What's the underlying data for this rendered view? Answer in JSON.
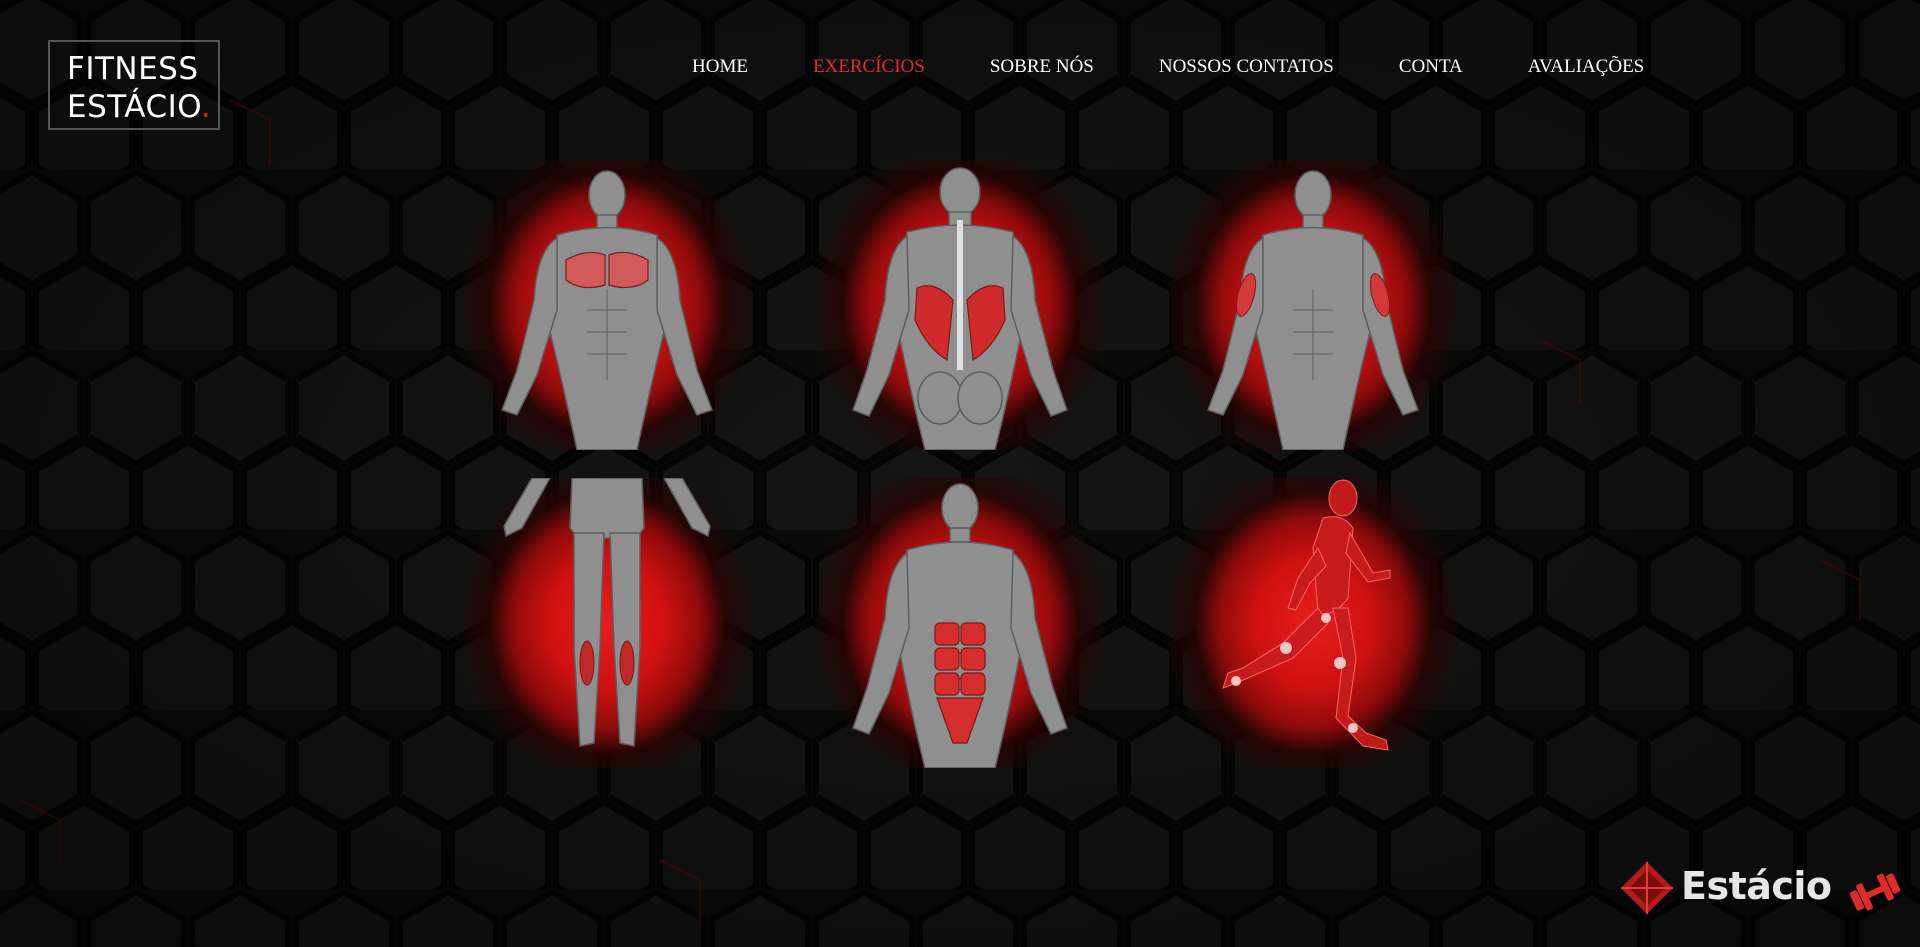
{
  "logo": {
    "line1": "FITNESS",
    "line2": "ESTÁCIO",
    "dot": "."
  },
  "nav": {
    "items": [
      {
        "label": "HOME",
        "active": false
      },
      {
        "label": "EXERCÍCIOS",
        "active": true
      },
      {
        "label": "SOBRE NÓS",
        "active": false
      },
      {
        "label": "NOSSOS CONTATOS",
        "active": false
      },
      {
        "label": "CONTA",
        "active": false
      },
      {
        "label": "AVALIAÇÕES",
        "active": false
      }
    ]
  },
  "exercise_cards": [
    {
      "muscle_group": "chest",
      "view": "front"
    },
    {
      "muscle_group": "back",
      "view": "back"
    },
    {
      "muscle_group": "arms",
      "view": "front"
    },
    {
      "muscle_group": "legs",
      "view": "back"
    },
    {
      "muscle_group": "abdomen",
      "view": "front"
    },
    {
      "muscle_group": "cardio",
      "view": "side-running"
    }
  ],
  "brand": {
    "name": "Estácio"
  },
  "colors": {
    "accent": "#e82a2a",
    "background": "#0b0b0b",
    "text": "#ffffff"
  }
}
